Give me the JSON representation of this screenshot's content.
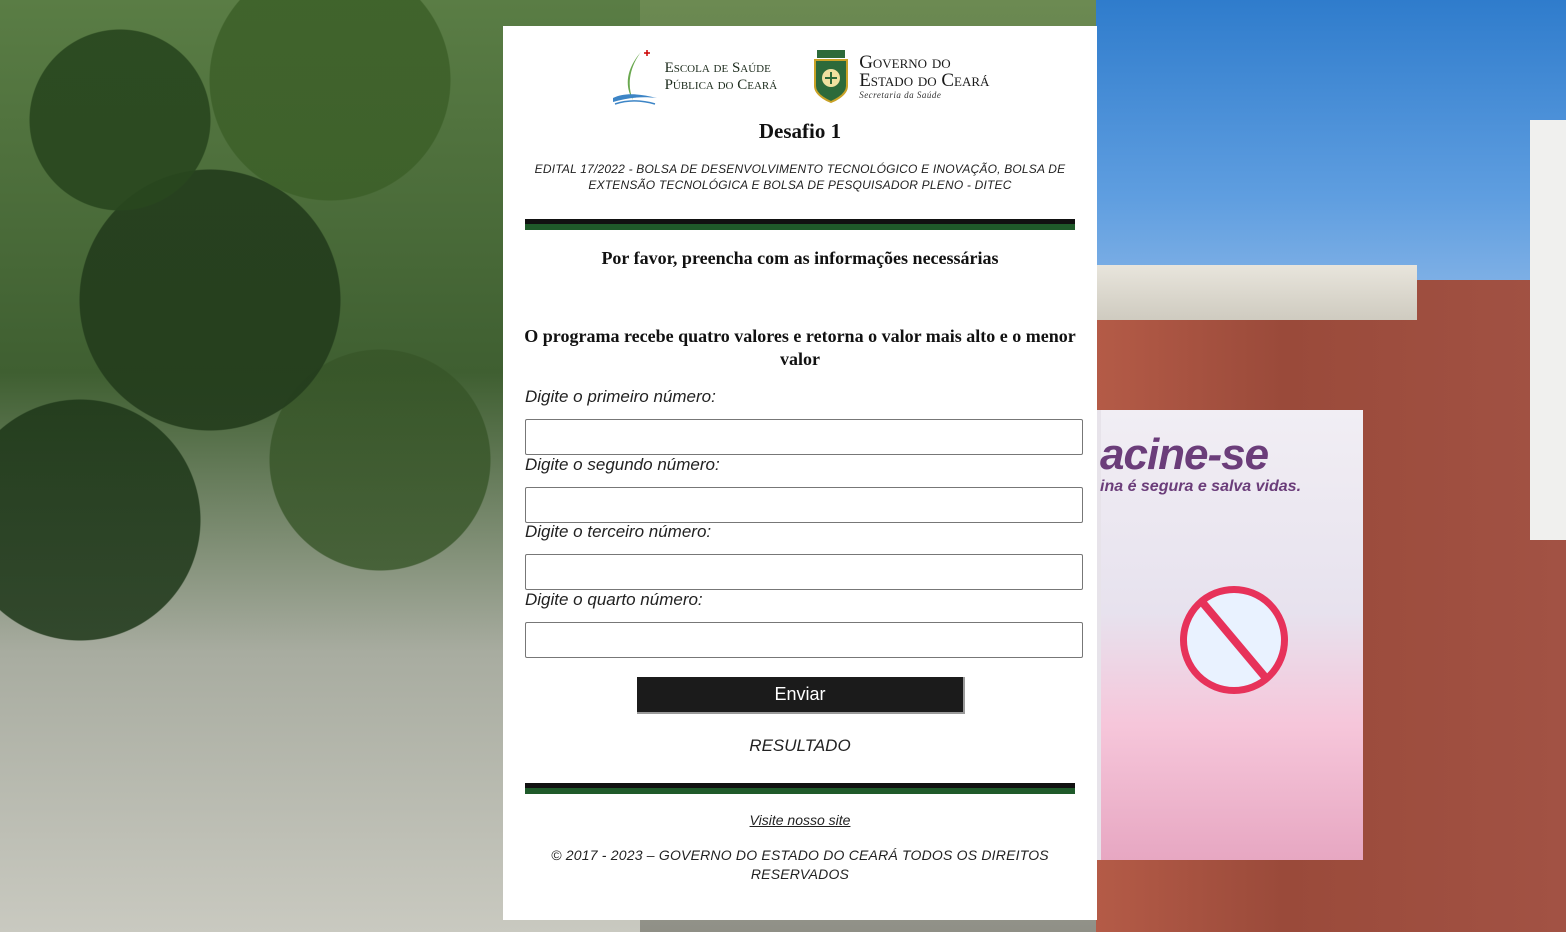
{
  "logos": {
    "esp_line1": "Escola de Saúde",
    "esp_line2": "Pública do Ceará",
    "gov_line1": "Governo do",
    "gov_line2": "Estado do Ceará",
    "gov_sub": "Secretaria da Saúde"
  },
  "header": {
    "title": "Desafio 1",
    "edital": "EDITAL 17/2022 - BOLSA DE DESENVOLVIMENTO TECNOLÓGICO E INOVAÇÃO, BOLSA DE EXTENSÃO TECNOLÓGICA E BOLSA DE PESQUISADOR PLENO - DITEC"
  },
  "form": {
    "subtitle": "Por favor, preencha com as informações necessárias",
    "description": "O programa recebe quatro valores e retorna o valor mais alto e o menor valor",
    "fields": [
      {
        "label": "Digite o primeiro número:",
        "value": ""
      },
      {
        "label": "Digite o segundo número:",
        "value": ""
      },
      {
        "label": "Digite o terceiro número:",
        "value": ""
      },
      {
        "label": "Digite o quarto número:",
        "value": ""
      }
    ],
    "submit_label": "Enviar",
    "result_label": "RESULTADO"
  },
  "footer": {
    "site_link": "Visite nosso site",
    "copyright": "© 2017 - 2023 – GOVERNO DO ESTADO DO CEARÁ TODOS OS DIREITOS RESERVADOS"
  },
  "background": {
    "banner_title": "acine-se",
    "banner_subtitle": "ina é segura e salva vidas."
  },
  "colors": {
    "rule_dark": "#111111",
    "rule_green": "#1f5a2a",
    "button_bg": "#1b1b1b"
  }
}
